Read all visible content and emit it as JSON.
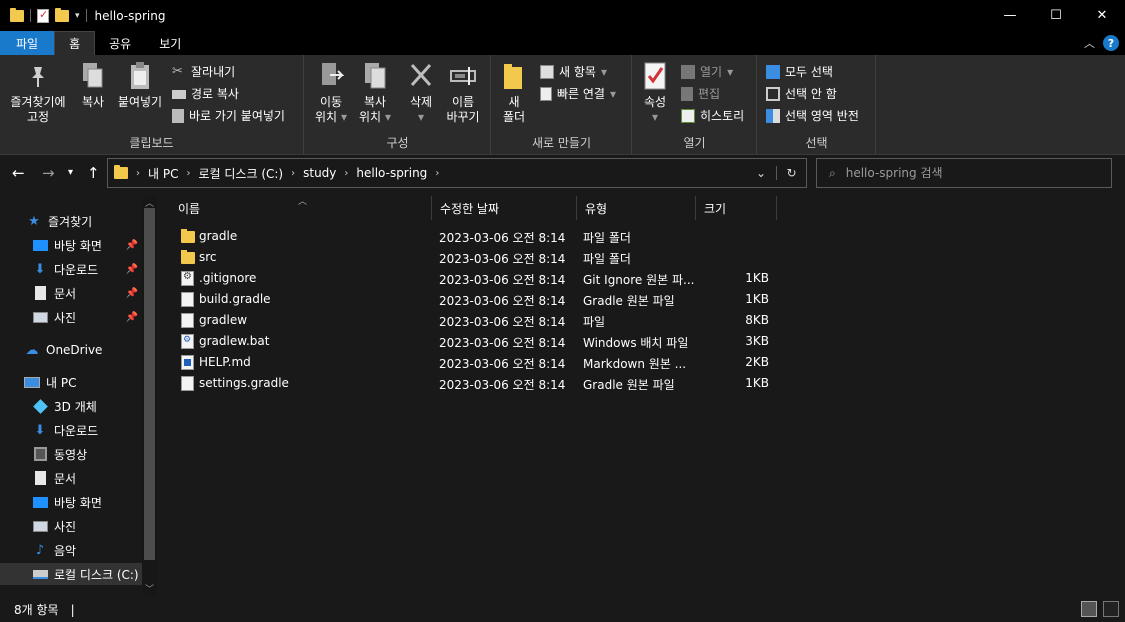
{
  "window": {
    "title": "hello-spring",
    "minimize": "—",
    "maximize": "☐",
    "close": "✕"
  },
  "ribbon_tabs": [
    "파일",
    "홈",
    "공유",
    "보기"
  ],
  "ribbon": {
    "clipboard": {
      "pin_label_1": "즐겨찾기에",
      "pin_label_2": "고정",
      "copy": "복사",
      "paste": "붙여넣기",
      "cut": "잘라내기",
      "copy_path": "경로 복사",
      "paste_shortcut": "바로 가기 붙여넣기",
      "group": "클립보드"
    },
    "organize": {
      "move_1": "이동",
      "move_2": "위치",
      "copy_1": "복사",
      "copy_2": "위치",
      "delete": "삭제",
      "rename_1": "이름",
      "rename_2": "바꾸기",
      "group": "구성"
    },
    "new": {
      "new_folder_1": "새",
      "new_folder_2": "폴더",
      "new_item": "새 항목",
      "easy_access": "빠른 연결",
      "group": "새로 만들기"
    },
    "open": {
      "properties": "속성",
      "open": "열기",
      "edit": "편집",
      "history": "히스토리",
      "group": "열기"
    },
    "select": {
      "select_all": "모두 선택",
      "select_none": "선택 안 함",
      "invert": "선택 영역 반전",
      "group": "선택"
    }
  },
  "address": {
    "crumbs": [
      "내 PC",
      "로컬 디스크 (C:)",
      "study",
      "hello-spring"
    ],
    "search_placeholder": "hello-spring 검색"
  },
  "sidebar": {
    "items": [
      {
        "label": "즐겨찾기",
        "icon": "star-icon"
      },
      {
        "label": "바탕 화면",
        "icon": "desktop-icon",
        "pinned": true
      },
      {
        "label": "다운로드",
        "icon": "download-icon",
        "pinned": true
      },
      {
        "label": "문서",
        "icon": "document-icon",
        "pinned": true
      },
      {
        "label": "사진",
        "icon": "picture-icon",
        "pinned": true
      },
      {
        "label": "OneDrive",
        "icon": "cloud-icon"
      },
      {
        "label": "내 PC",
        "icon": "pc-icon"
      },
      {
        "label": "3D 개체",
        "icon": "cube-icon"
      },
      {
        "label": "다운로드",
        "icon": "download-icon"
      },
      {
        "label": "동영상",
        "icon": "video-icon"
      },
      {
        "label": "문서",
        "icon": "document-icon"
      },
      {
        "label": "바탕 화면",
        "icon": "desktop-icon"
      },
      {
        "label": "사진",
        "icon": "picture-icon"
      },
      {
        "label": "음악",
        "icon": "music-icon"
      },
      {
        "label": "로컬 디스크 (C:)",
        "icon": "drive-icon",
        "selected": true
      }
    ]
  },
  "columns": [
    "이름",
    "수정한 날짜",
    "유형",
    "크기"
  ],
  "files": [
    {
      "name": "gradle",
      "date": "2023-03-06 오전 8:14",
      "type": "파일 폴더",
      "size": "",
      "icon": "folder"
    },
    {
      "name": "src",
      "date": "2023-03-06 오전 8:14",
      "type": "파일 폴더",
      "size": "",
      "icon": "folder"
    },
    {
      "name": ".gitignore",
      "date": "2023-03-06 오전 8:14",
      "type": "Git Ignore 원본 파...",
      "size": "1KB",
      "icon": "cfg"
    },
    {
      "name": "build.gradle",
      "date": "2023-03-06 오전 8:14",
      "type": "Gradle 원본 파일",
      "size": "1KB",
      "icon": "doc"
    },
    {
      "name": "gradlew",
      "date": "2023-03-06 오전 8:14",
      "type": "파일",
      "size": "8KB",
      "icon": "doc"
    },
    {
      "name": "gradlew.bat",
      "date": "2023-03-06 오전 8:14",
      "type": "Windows 배치 파일",
      "size": "3KB",
      "icon": "bat"
    },
    {
      "name": "HELP.md",
      "date": "2023-03-06 오전 8:14",
      "type": "Markdown 원본 ...",
      "size": "2KB",
      "icon": "md"
    },
    {
      "name": "settings.gradle",
      "date": "2023-03-06 오전 8:14",
      "type": "Gradle 원본 파일",
      "size": "1KB",
      "icon": "doc"
    }
  ],
  "status": {
    "count": "8개 항목",
    "separator": "|"
  },
  "colors": {
    "file_tab": "#1979ca",
    "background": "#191919",
    "ribbon": "#2b2b2b",
    "folder": "#f2c94c"
  }
}
